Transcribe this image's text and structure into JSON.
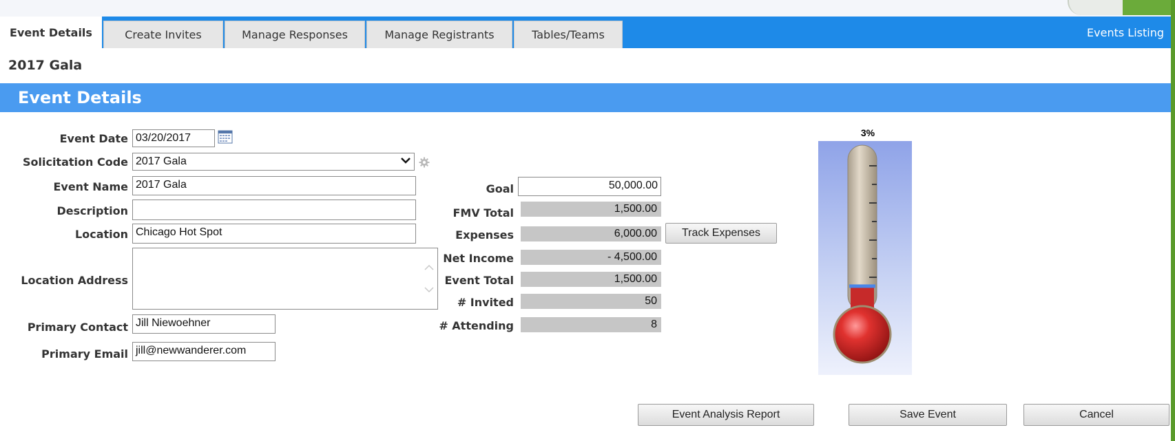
{
  "tabs": [
    {
      "label": "Event Details",
      "active": true
    },
    {
      "label": "Create Invites",
      "active": false
    },
    {
      "label": "Manage Responses",
      "active": false
    },
    {
      "label": "Manage Registrants",
      "active": false
    },
    {
      "label": "Tables/Teams",
      "active": false
    }
  ],
  "events_listing": "Events Listing",
  "page_title": "2017 Gala",
  "section_title": "Event Details",
  "form": {
    "event_date": {
      "label": "Event Date",
      "value": "03/20/2017"
    },
    "solicitation_code": {
      "label": "Solicitation Code",
      "value": "2017 Gala"
    },
    "event_name": {
      "label": "Event Name",
      "value": "2017 Gala"
    },
    "description": {
      "label": "Description",
      "value": ""
    },
    "location": {
      "label": "Location",
      "value": "Chicago Hot Spot"
    },
    "location_address": {
      "label": "Location Address",
      "value": ""
    },
    "primary_contact": {
      "label": "Primary Contact",
      "value": "Jill Niewoehner"
    },
    "primary_email": {
      "label": "Primary Email",
      "value": "jill@newwanderer.com"
    }
  },
  "totals": {
    "goal": {
      "label": "Goal",
      "value": "50,000.00"
    },
    "fmv_total": {
      "label": "FMV Total",
      "value": "1,500.00"
    },
    "expenses": {
      "label": "Expenses",
      "value": "6,000.00"
    },
    "net_income": {
      "label": "Net Income",
      "value": "- 4,500.00"
    },
    "event_total": {
      "label": "Event Total",
      "value": "1,500.00"
    },
    "invited": {
      "label": "# Invited",
      "value": "50"
    },
    "attending": {
      "label": "# Attending",
      "value": "8"
    }
  },
  "track_expenses_label": "Track Expenses",
  "thermometer": {
    "percent_label": "3%",
    "fill_fraction": 0.03,
    "fill_color": "#4a86e8"
  },
  "buttons": {
    "analysis": "Event Analysis Report",
    "save": "Save Event",
    "cancel": "Cancel"
  },
  "colors": {
    "tab_bar": "#1e8ae8",
    "section_bar": "#4a9bf0"
  },
  "icons": {
    "calendar": "calendar-icon",
    "gear": "gear-icon",
    "dropdown": "chevron-down-icon"
  }
}
